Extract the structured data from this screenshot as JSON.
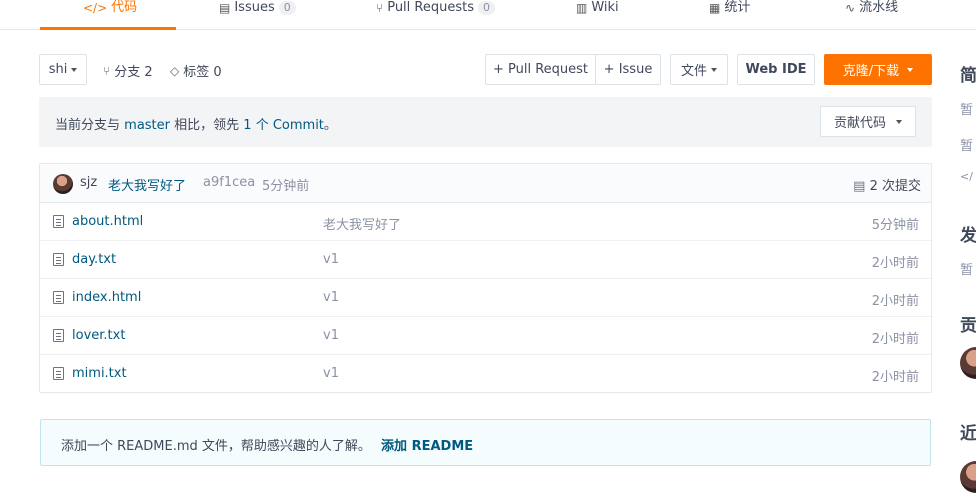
{
  "tabs": [
    {
      "icon": "</>",
      "label": "代码",
      "count": ""
    },
    {
      "icon": "▤",
      "label": "Issues",
      "count": "0"
    },
    {
      "icon": "⑂",
      "label": "Pull Requests",
      "count": "0"
    },
    {
      "icon": "▥",
      "label": "Wiki",
      "count": ""
    },
    {
      "icon": "▦",
      "label": "统计",
      "count": ""
    },
    {
      "icon": "∿",
      "label": "流水线",
      "count": ""
    }
  ],
  "toolbar": {
    "branch_select": "shi",
    "branches": "分支 2",
    "tags": "标签 0",
    "pull_request": "+ Pull Request",
    "issue": "+ Issue",
    "file_menu": "文件",
    "web_ide": "Web IDE",
    "clone": "克隆/下载"
  },
  "banner": {
    "prefix": "当前分支与",
    "branch": "master",
    "middle": "相比，领先",
    "count": "1 个 Commit",
    "suffix": "。",
    "contribute": "贡献代码"
  },
  "commit": {
    "author": "sjz",
    "message": "老大我写好了",
    "hash": "a9f1cea",
    "time": "5分钟前",
    "commits_label": "2 次提交"
  },
  "files": [
    {
      "name": "about.html",
      "message": "老大我写好了",
      "time": "5分钟前"
    },
    {
      "name": "day.txt",
      "message": "v1",
      "time": "2小时前"
    },
    {
      "name": "index.html",
      "message": "v1",
      "time": "2小时前"
    },
    {
      "name": "lover.txt",
      "message": "v1",
      "time": "2小时前"
    },
    {
      "name": "mimi.txt",
      "message": "v1",
      "time": "2小时前"
    }
  ],
  "readme": {
    "text": "添加一个 README.md 文件，帮助感兴趣的人了解。",
    "link": "添加 README"
  },
  "sidebar": {
    "h1": "简",
    "t1": "暂",
    "t2": "暂",
    "t3": "</",
    "h2": "发",
    "t4": "暂",
    "h3": "贡",
    "h4": "近"
  },
  "colors": {
    "accent": "#fe7300",
    "link": "#005980",
    "muted": "#8c92a4",
    "text": "#40485b"
  }
}
